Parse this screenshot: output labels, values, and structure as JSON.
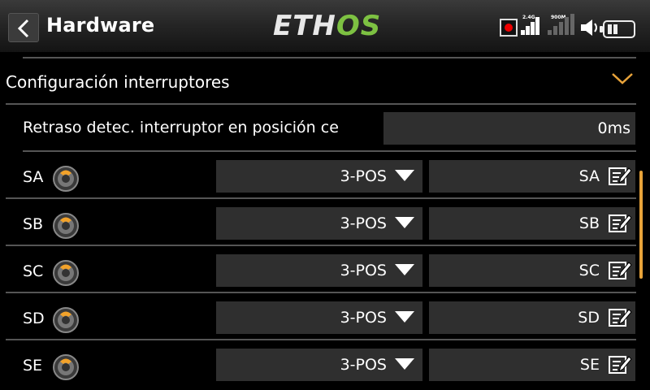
{
  "header": {
    "title": "Hardware",
    "logo_main": "ETH",
    "logo_accent": "OS",
    "rf_label_1": "2.4G",
    "rf_label_2": "900M"
  },
  "section": {
    "title": "Configuración interruptores"
  },
  "delay": {
    "label": "Retraso detec. interruptor en posición ce",
    "value": "0ms"
  },
  "switches": [
    {
      "name": "SA",
      "type": "3-POS",
      "alias": "SA"
    },
    {
      "name": "SB",
      "type": "3-POS",
      "alias": "SB"
    },
    {
      "name": "SC",
      "type": "3-POS",
      "alias": "SC"
    },
    {
      "name": "SD",
      "type": "3-POS",
      "alias": "SD"
    },
    {
      "name": "SE",
      "type": "3-POS",
      "alias": "SE"
    }
  ],
  "colors": {
    "accent": "#e8a33a",
    "logo_green": "#7dc142",
    "record": "#e00000",
    "field_bg": "#2f2f2f"
  }
}
